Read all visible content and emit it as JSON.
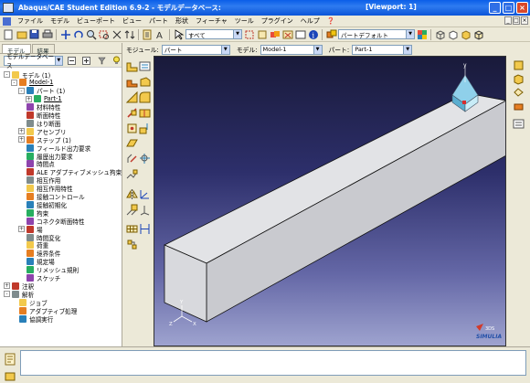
{
  "window": {
    "title": "Abaqus/CAE Student Edition 6.9-2 - モデルデータベース:",
    "viewport_label": "[Viewport: 1]",
    "min_glyph": "_",
    "max_glyph": "□",
    "close_glyph": "×"
  },
  "menubar": {
    "items": [
      "ファイル",
      "モデル",
      "ビューポート",
      "ビュー",
      "パート",
      "形状",
      "フィーチャ",
      "ツール",
      "プラグイン",
      "ヘルプ",
      "❓"
    ]
  },
  "toolbar": {
    "selection_filter": "すべて",
    "display_group": "パートデフォルト"
  },
  "left_panel": {
    "tabs": [
      "モデル",
      "結果"
    ],
    "tree_filter": "モデルデータベース",
    "tree": [
      {
        "label": "モデル (1)",
        "level": 0,
        "expander": "-"
      },
      {
        "label": "Model-1",
        "level": 1,
        "expander": "-",
        "underline": true
      },
      {
        "label": "パート (1)",
        "level": 2,
        "expander": "-"
      },
      {
        "label": "Part-1",
        "level": 3,
        "expander": "+",
        "underline": true
      },
      {
        "label": "材料特性",
        "level": 2,
        "expander": ""
      },
      {
        "label": "断面特性",
        "level": 2,
        "expander": ""
      },
      {
        "label": "はり断面",
        "level": 2,
        "expander": ""
      },
      {
        "label": "アセンブリ",
        "level": 2,
        "expander": "+"
      },
      {
        "label": "ステップ (1)",
        "level": 2,
        "expander": "+"
      },
      {
        "label": "フィールド出力要求",
        "level": 2,
        "expander": ""
      },
      {
        "label": "履歴出力要求",
        "level": 2,
        "expander": ""
      },
      {
        "label": "時間点",
        "level": 2,
        "expander": ""
      },
      {
        "label": "ALE アダプティブメッシュ拘束",
        "level": 2,
        "expander": ""
      },
      {
        "label": "相互作用",
        "level": 2,
        "expander": ""
      },
      {
        "label": "相互作用特性",
        "level": 2,
        "expander": ""
      },
      {
        "label": "接触コントロール",
        "level": 2,
        "expander": ""
      },
      {
        "label": "接触初期化",
        "level": 2,
        "expander": ""
      },
      {
        "label": "拘束",
        "level": 2,
        "expander": ""
      },
      {
        "label": "コネクタ断面特性",
        "level": 2,
        "expander": ""
      },
      {
        "label": "場",
        "level": 2,
        "expander": "+"
      },
      {
        "label": "時間変化",
        "level": 2,
        "expander": ""
      },
      {
        "label": "荷重",
        "level": 2,
        "expander": ""
      },
      {
        "label": "境界条件",
        "level": 2,
        "expander": ""
      },
      {
        "label": "規定場",
        "level": 2,
        "expander": ""
      },
      {
        "label": "リメッシュ規則",
        "level": 2,
        "expander": ""
      },
      {
        "label": "スケッチ",
        "level": 2,
        "expander": ""
      },
      {
        "label": "注釈",
        "level": 0,
        "expander": "+"
      },
      {
        "label": "解析",
        "level": 0,
        "expander": "-"
      },
      {
        "label": "ジョブ",
        "level": 1,
        "expander": ""
      },
      {
        "label": "アダプティブ処理",
        "level": 1,
        "expander": ""
      },
      {
        "label": "協調実行",
        "level": 1,
        "expander": ""
      }
    ]
  },
  "module_bar": {
    "module_label": "モジュール:",
    "module_value": "パート",
    "model_label": "モデル:",
    "model_value": "Model-1",
    "part_label": "パート:",
    "part_value": "Part-1"
  },
  "viewport": {
    "triad_labels": {
      "x": "X",
      "y": "Y",
      "z": "Z"
    },
    "view_cube_axis": "y",
    "brand": "SIMULIA"
  },
  "colors": {
    "accent_titlebar": "#0b55d8",
    "viewport_top": "#191a3a",
    "viewport_bottom": "#9ea3cf",
    "part_face_top": "#e2e3e6",
    "part_face_front": "#cfd0d4"
  }
}
